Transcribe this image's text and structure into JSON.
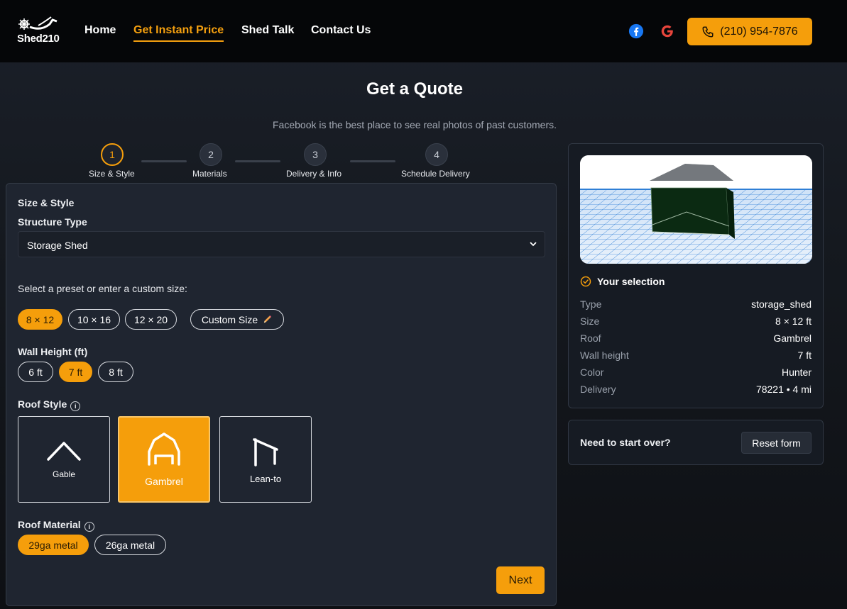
{
  "header": {
    "logo_text": "Shed210",
    "nav": [
      "Home",
      "Get Instant Price",
      "Shed Talk",
      "Contact Us"
    ],
    "active_nav": "Get Instant Price",
    "phone": "(210) 954-7876"
  },
  "page": {
    "title": "Get a Quote",
    "subtitle": "Facebook is the best place to see real photos of past customers."
  },
  "steps": [
    {
      "num": "1",
      "label": "Size & Style"
    },
    {
      "num": "2",
      "label": "Materials"
    },
    {
      "num": "3",
      "label": "Delivery & Info"
    },
    {
      "num": "4",
      "label": "Schedule Delivery"
    }
  ],
  "form": {
    "section_title": "Size & Style",
    "structure_label": "Structure Type",
    "structure_value": "Storage Shed",
    "preset_prompt": "Select a preset or enter a custom size:",
    "presets": [
      "8 × 12",
      "10 × 16",
      "12 × 20"
    ],
    "custom_size": "Custom Size",
    "wall_height_label": "Wall Height (ft)",
    "wall_heights": [
      "6 ft",
      "7 ft",
      "8 ft"
    ],
    "roof_style_label": "Roof Style",
    "roof_styles": [
      "Gable",
      "Gambrel",
      "Lean-to"
    ],
    "roof_material_label": "Roof Material",
    "roof_materials": [
      "29ga metal",
      "26ga metal"
    ],
    "next": "Next"
  },
  "summary": {
    "title": "Your selection",
    "rows": [
      {
        "k": "Type",
        "v": "storage_shed"
      },
      {
        "k": "Size",
        "v": "8 × 12 ft"
      },
      {
        "k": "Roof",
        "v": "Gambrel"
      },
      {
        "k": "Wall height",
        "v": "7 ft"
      },
      {
        "k": "Color",
        "v": "Hunter"
      },
      {
        "k": "Delivery",
        "v": "78221 • 4 mi"
      }
    ],
    "reset_prompt": "Need to start over?",
    "reset_label": "Reset form"
  },
  "colors": {
    "accent": "#f59e0b",
    "shed_color": "#0b2a12"
  },
  "icons": [
    "phone-icon",
    "facebook-icon",
    "google-icon",
    "pencil-icon",
    "check-circle-icon",
    "info-icon",
    "chevron-down-icon"
  ]
}
